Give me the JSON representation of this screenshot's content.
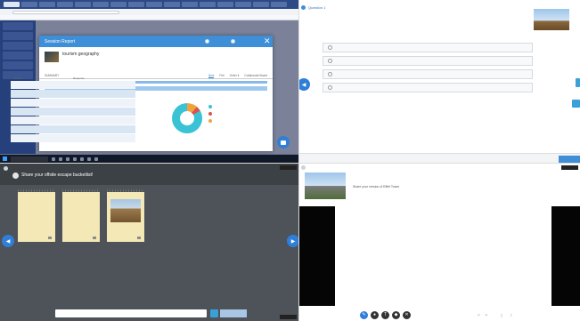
{
  "q1": {
    "tabs": [
      "",
      "",
      "",
      "",
      "",
      "",
      "",
      "",
      "",
      "",
      "",
      "",
      "",
      "",
      "",
      ""
    ],
    "url": "",
    "bookmarks": [
      "",
      "",
      "",
      "",
      "",
      "",
      "",
      "",
      "",
      ""
    ],
    "modal": {
      "title": "Session Report",
      "toggles": [
        "",
        ""
      ],
      "lesson_title": "tourism geography",
      "lesson_sub": "",
      "summary_label": "SUMMARY",
      "tabs": [
        "Quiz",
        "Poll",
        "Order it",
        "Collaborate Board"
      ],
      "question_bar": "",
      "table_headers": [
        "Student",
        "Response"
      ],
      "rows": [
        {
          "name": "",
          "resp": ""
        },
        {
          "name": "",
          "resp": ""
        },
        {
          "name": "",
          "resp": ""
        },
        {
          "name": "",
          "resp": ""
        },
        {
          "name": "",
          "resp": ""
        },
        {
          "name": "",
          "resp": ""
        },
        {
          "name": "",
          "resp": ""
        }
      ],
      "legend": [
        "",
        "",
        ""
      ],
      "colors": {
        "correct": "#39c3d4",
        "incorrect": "#d9534f",
        "other": "#f0a33c"
      }
    },
    "taskbar": {
      "search": "",
      "time": ""
    }
  },
  "q2": {
    "label": "Question 1",
    "question": "",
    "options": [
      "",
      "",
      "",
      ""
    ],
    "submit": "",
    "next": ""
  },
  "q3": {
    "title": "Share your offsite escape bucketlist!",
    "subtitle": "",
    "corner": "",
    "cards": [
      {
        "text": ""
      },
      {
        "text": ""
      },
      {
        "text": "",
        "label": ""
      }
    ],
    "input_placeholder": "",
    "button": ""
  },
  "q4": {
    "title": "Share your version of Eiffel Tower"
  }
}
